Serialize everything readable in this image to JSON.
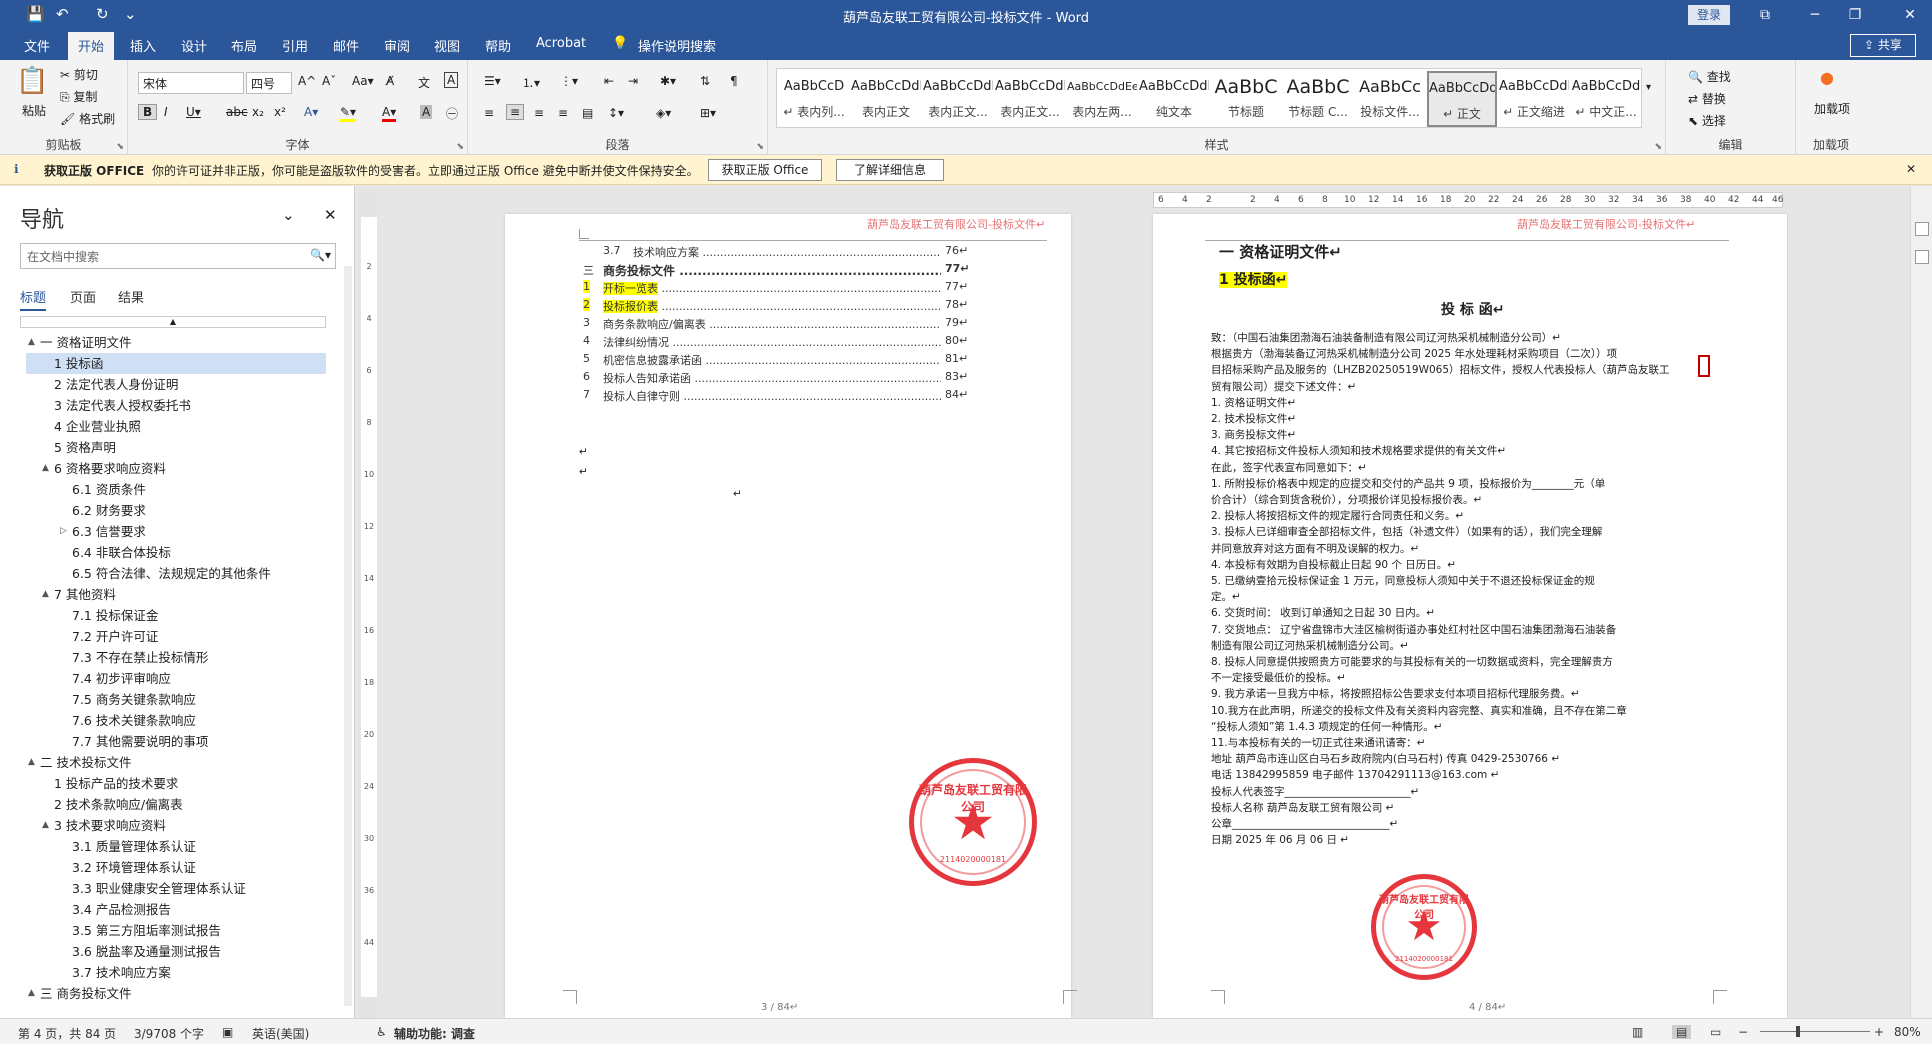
{
  "titlebar": {
    "title": "葫芦岛友联工贸有限公司-投标文件  -  Word",
    "login": "登录",
    "qa_save": "💾",
    "qa_undo": "↶",
    "qa_redo": "↻",
    "qa_more": "⌄",
    "win_restore": "⧉",
    "win_min": "─",
    "win_max": "❐",
    "win_close": "✕"
  },
  "tabs": [
    "文件",
    "开始",
    "插入",
    "设计",
    "布局",
    "引用",
    "邮件",
    "审阅",
    "视图",
    "帮助",
    "Acrobat",
    "操作说明搜索"
  ],
  "share": "共享",
  "ribbon": {
    "clipboard": {
      "label": "剪贴板",
      "paste": "粘贴",
      "cut": "剪切",
      "copy": "复制",
      "format_painter": "格式刷"
    },
    "font": {
      "label": "字体",
      "font_name": "宋体",
      "font_size": "四号"
    },
    "paragraph": {
      "label": "段落"
    },
    "styles": {
      "label": "样式",
      "items": [
        {
          "preview": "AaBbCcD",
          "name": "↵ 表内列..."
        },
        {
          "preview": "AaBbCcDdI",
          "name": "表内正文"
        },
        {
          "preview": "AaBbCcDdI",
          "name": "表内正文..."
        },
        {
          "preview": "AaBbCcDdI",
          "name": "表内正文..."
        },
        {
          "preview": "AaBbCcDdEe",
          "name": "表内左两..."
        },
        {
          "preview": "AaBbCcDdI",
          "name": "纯文本"
        },
        {
          "preview": "AaBbC",
          "name": "节标题"
        },
        {
          "preview": "AaBbC",
          "name": "节标题 C..."
        },
        {
          "preview": "AaBbCc",
          "name": "投标文件..."
        },
        {
          "preview": "AaBbCcDdI",
          "name": "↵ 正文"
        },
        {
          "preview": "AaBbCcDdI",
          "name": "↵ 正文缩进"
        },
        {
          "preview": "AaBbCcDd",
          "name": "↵ 中文正..."
        }
      ]
    },
    "editing": {
      "label": "编辑",
      "find": "查找",
      "replace": "替换",
      "select": "选择"
    },
    "addins": {
      "label": "加载项",
      "button": "加载项"
    }
  },
  "infobar": {
    "title": "获取正版 OFFICE",
    "message": "你的许可证并非正版，你可能是盗版软件的受害者。立即通过正版 Office 避免中断并使文件保持安全。",
    "btn_get": "获取正版 Office",
    "btn_learn": "了解详细信息"
  },
  "nav": {
    "title": "导航",
    "search_placeholder": "在文档中搜索",
    "tabs": [
      "标题",
      "页面",
      "结果"
    ],
    "items": [
      {
        "text": "一 资格证明文件",
        "level": 0,
        "arrow": "▲",
        "selected": false
      },
      {
        "text": "1 投标函",
        "level": 1,
        "arrow": "",
        "selected": true
      },
      {
        "text": "2 法定代表人身份证明",
        "level": 1,
        "arrow": "",
        "selected": false
      },
      {
        "text": "3 法定代表人授权委托书",
        "level": 1,
        "arrow": "",
        "selected": false
      },
      {
        "text": "4 企业营业执照",
        "level": 1,
        "arrow": "",
        "selected": false
      },
      {
        "text": "5 资格声明",
        "level": 1,
        "arrow": "",
        "selected": false
      },
      {
        "text": "6 资格要求响应资料",
        "level": 1,
        "arrow": "▲",
        "selected": false
      },
      {
        "text": "6.1 资质条件",
        "level": 2,
        "arrow": "",
        "selected": false
      },
      {
        "text": "6.2 财务要求",
        "level": 2,
        "arrow": "",
        "selected": false
      },
      {
        "text": "6.3 信誉要求",
        "level": 2,
        "arrow": "▷",
        "selected": false
      },
      {
        "text": "6.4 非联合体投标",
        "level": 2,
        "arrow": "",
        "selected": false
      },
      {
        "text": "6.5 符合法律、法规规定的其他条件",
        "level": 2,
        "arrow": "",
        "selected": false
      },
      {
        "text": "7 其他资料",
        "level": 1,
        "arrow": "▲",
        "selected": false
      },
      {
        "text": "7.1 投标保证金",
        "level": 2,
        "arrow": "",
        "selected": false
      },
      {
        "text": "7.2 开户许可证",
        "level": 2,
        "arrow": "",
        "selected": false
      },
      {
        "text": "7.3 不存在禁止投标情形",
        "level": 2,
        "arrow": "",
        "selected": false
      },
      {
        "text": "7.4 初步评审响应",
        "level": 2,
        "arrow": "",
        "selected": false
      },
      {
        "text": "7.5 商务关键条款响应",
        "level": 2,
        "arrow": "",
        "selected": false
      },
      {
        "text": "7.6 技术关键条款响应",
        "level": 2,
        "arrow": "",
        "selected": false
      },
      {
        "text": "7.7 其他需要说明的事项",
        "level": 2,
        "arrow": "",
        "selected": false
      },
      {
        "text": "二 技术投标文件",
        "level": 0,
        "arrow": "▲",
        "selected": false
      },
      {
        "text": "1 投标产品的技术要求",
        "level": 1,
        "arrow": "",
        "selected": false
      },
      {
        "text": "2 技术条款响应/偏离表",
        "level": 1,
        "arrow": "",
        "selected": false
      },
      {
        "text": "3 技术要求响应资料",
        "level": 1,
        "arrow": "▲",
        "selected": false
      },
      {
        "text": "3.1 质量管理体系认证",
        "level": 2,
        "arrow": "",
        "selected": false
      },
      {
        "text": "3.2 环境管理体系认证",
        "level": 2,
        "arrow": "",
        "selected": false
      },
      {
        "text": "3.3 职业健康安全管理体系认证",
        "level": 2,
        "arrow": "",
        "selected": false
      },
      {
        "text": "3.4 产品检测报告",
        "level": 2,
        "arrow": "",
        "selected": false
      },
      {
        "text": "3.5 第三方阻垢率测试报告",
        "level": 2,
        "arrow": "",
        "selected": false
      },
      {
        "text": "3.6 脱盐率及通量测试报告",
        "level": 2,
        "arrow": "",
        "selected": false
      },
      {
        "text": "3.7 技术响应方案",
        "level": 2,
        "arrow": "",
        "selected": false
      },
      {
        "text": "三 商务投标文件",
        "level": 0,
        "arrow": "▲",
        "selected": false
      }
    ]
  },
  "page3": {
    "header": "葫芦岛友联工贸有限公司-投标文件↵",
    "toc": [
      {
        "num": "3.7",
        "text": "技术响应方案",
        "page": "76↵",
        "hl": false,
        "bold": false
      },
      {
        "num": "三",
        "text": "商务投标文件",
        "page": "77↵",
        "hl": false,
        "bold": true
      },
      {
        "num": "1",
        "text": "开标一览表",
        "page": "77↵",
        "hl": true,
        "bold": false
      },
      {
        "num": "2",
        "text": "投标报价表",
        "page": "78↵",
        "hl": true,
        "bold": false
      },
      {
        "num": "3",
        "text": "商务条款响应/偏离表",
        "page": "79↵",
        "hl": false,
        "bold": false
      },
      {
        "num": "4",
        "text": "法律纠纷情况",
        "page": "80↵",
        "hl": false,
        "bold": false
      },
      {
        "num": "5",
        "text": "机密信息披露承诺函",
        "page": "81↵",
        "hl": false,
        "bold": false
      },
      {
        "num": "6",
        "text": "投标人告知承诺函",
        "page": "83↵",
        "hl": false,
        "bold": false
      },
      {
        "num": "7",
        "text": "投标人自律守则",
        "page": "84↵",
        "hl": false,
        "bold": false
      }
    ],
    "para_mark": "↵",
    "footer": "3 / 84↵",
    "stamp_name": "葫芦岛友联工贸有限公司",
    "stamp_code": "2114020000181"
  },
  "page4": {
    "header": "葫芦岛友联工贸有限公司-投标文件↵",
    "h1": "一 资格证明文件↵",
    "h2": "1  投标函↵",
    "letter_title": "投 标 函↵",
    "lines": [
      "致：（中国石油集团渤海石油装备制造有限公司辽河热采机械制造分公司）↵",
      "    根据贵方（渤海装备辽河热采机械制造分公司 2025 年水处理耗材采购项目（二次））项",
      "目招标采购产品及服务的（LHZB20250519W065）招标文件，授权人代表投标人（葫芦岛友联工",
      "贸有限公司）提交下述文件：↵",
      "    1.  资格证明文件↵",
      "    2.  技术投标文件↵",
      "    3.  商务投标文件↵",
      "    4.  其它按招标文件投标人须知和技术规格要求提供的有关文件↵",
      "    在此，签字代表宣布同意如下：↵",
      "    1.  所附投标价格表中规定的应提交和交付的产品共  9  项，投标报价为________元（单",
      "价合计）（综合到货含税价），分项报价详见投标报价表。↵",
      "    2.  投标人将按招标文件的规定履行合同责任和义务。↵",
      "    3.  投标人已详细审查全部招标文件，包括（补遗文件）（如果有的话），我们完全理解",
      "并同意放弃对这方面有不明及误解的权力。↵",
      "    4.  本投标有效期为自投标截止日起  90 个  日历日。↵",
      "    5.  已缴纳壹拾元投标保证金  1  万元，同意投标人须知中关于不退还投标保证金的规",
      "定。↵",
      "    6.  交货时间：  收到订单通知之日起 30 日内。↵",
      "    7.  交货地点：  辽宁省盘锦市大洼区榆树街道办事处红村社区中国石油集团渤海石油装备",
      "制造有限公司辽河热采机械制造分公司。↵",
      "    8.  投标人同意提供按照贵方可能要求的与其投标有关的一切数据或资料，完全理解贵方",
      "不一定接受最低价的投标。↵",
      "    9.  我方承诺一旦我方中标，将按照招标公告要求支付本项目招标代理服务费。↵",
      "    10.我方在此声明，所递交的投标文件及有关资料内容完整、真实和准确，且不存在第二章",
      "“投标人须知”第 1.4.3 项规定的任何一种情形。↵",
      "    11.与本投标有关的一切正式往来通讯请寄：↵",
      "    地址   葫芦岛市连山区白马石乡政府院内(白马石村)   传真  0429-2530766  ↵",
      "    电话   13842995859         电子邮件  13704291113@163.com   ↵",
      "    投标人代表签字________________________↵",
      "    投标人名称   葫芦岛友联工贸有限公司   ↵",
      "    公章______________________________↵",
      "    日期   2025 年 06 月 06 日   ↵"
    ],
    "footer": "4 / 84↵",
    "stamp_name": "葫芦岛友联工贸有限公司",
    "stamp_code": "2114020000181"
  },
  "status": {
    "page": "第 4 页，共 84 页",
    "words": "3/9708 个字",
    "lang": "英语(美国)",
    "accessibility": "辅助功能: 调查",
    "zoom": "80%"
  }
}
